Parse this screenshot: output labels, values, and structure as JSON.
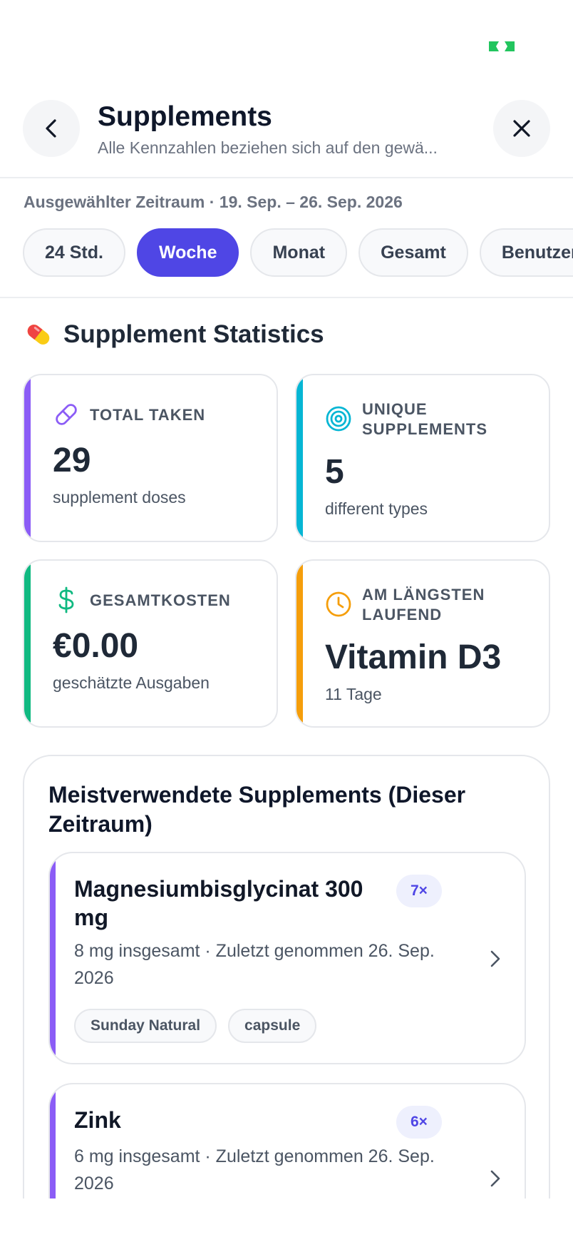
{
  "header": {
    "title": "Supplements",
    "subtitle": "Alle Kennzahlen beziehen sich auf den gewä..."
  },
  "range": {
    "label": "Ausgewählter Zeitraum · 19. Sep. – 26. Sep. 2026",
    "chips": [
      {
        "label": "24 Std.",
        "active": false
      },
      {
        "label": "Woche",
        "active": true
      },
      {
        "label": "Monat",
        "active": false
      },
      {
        "label": "Gesamt",
        "active": false
      },
      {
        "label": "Benutzerdefiniert",
        "active": false
      }
    ]
  },
  "stats": {
    "title": "Supplement Statistics",
    "cards": [
      {
        "label": "TOTAL TAKEN",
        "value": "29",
        "sub": "supplement doses",
        "color": "#8b5cf6",
        "icon": "pill-icon"
      },
      {
        "label": "UNIQUE SUPPLEMENTS",
        "value": "5",
        "sub": "different types",
        "color": "#06b6d4",
        "icon": "target-icon"
      },
      {
        "label": "GESAMTKOSTEN",
        "value": "€0.00",
        "sub": "geschätzte Ausgaben",
        "color": "#10b981",
        "icon": "dollar-icon"
      },
      {
        "label": "AM LÄNGSTEN LAUFEND",
        "value": "Vitamin D3",
        "sub": "11 Tage",
        "color": "#f59e0b",
        "icon": "clock-icon"
      }
    ]
  },
  "top_supplements": {
    "title": "Meistverwendete Supplements (Dieser Zeitraum)",
    "items": [
      {
        "name": "Magnesiumbisglycinat 300 mg",
        "count": "7×",
        "meta": "8 mg insgesamt · Zuletzt genommen 26. Sep. 2026",
        "tags": [
          "Sunday Natural",
          "capsule"
        ]
      },
      {
        "name": "Zink",
        "count": "6×",
        "meta": "6 mg insgesamt · Zuletzt genommen 26. Sep. 2026",
        "tags": []
      }
    ]
  },
  "colors": {
    "accent": "#4f46e5",
    "status_glyph": "#22c55e"
  }
}
